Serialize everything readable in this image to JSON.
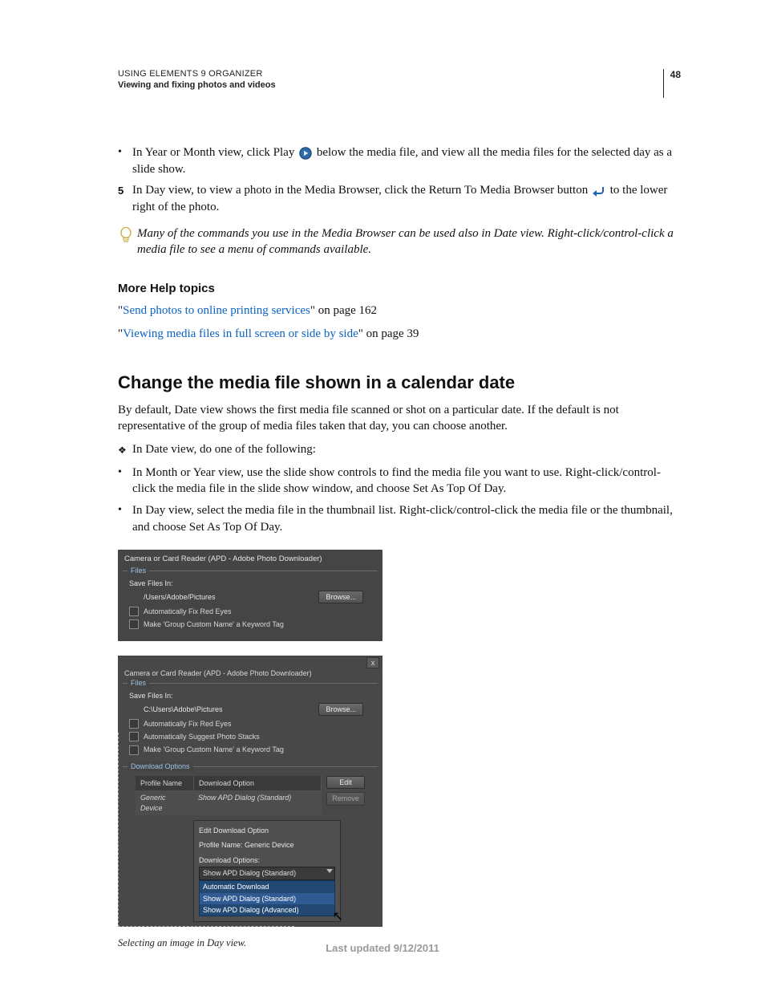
{
  "header": {
    "running_title": "USING ELEMENTS 9 ORGANIZER",
    "running_sub": "Viewing and fixing photos and videos",
    "page_number": "48"
  },
  "bullet1_a": "In Year or Month view, click Play ",
  "bullet1_b": " below the media file, and view all the media files for the selected day as a slide show.",
  "step5": {
    "num": "5",
    "a": "In Day view, to view a photo in the Media Browser, click the Return To Media Browser button ",
    "b": " to the lower right of the photo."
  },
  "tip": "Many of the commands you use in the Media Browser can be used also in Date view. Right-click/control-click a media file to see a menu of commands available.",
  "more_help": {
    "heading": "More Help topics",
    "link1": "Send photos to online printing services",
    "suffix1": "\" on page 162",
    "link2": "Viewing media files in full screen or side by side",
    "suffix2": "\" on page 39"
  },
  "section": {
    "h2": "Change the media file shown in a calendar date",
    "intro": "By default, Date view shows the first media file scanned or shot on a particular date. If the default is not representative of the group of media files taken that day, you can choose another.",
    "lead": "In Date view, do one of the following:",
    "b1": "In Month or Year view, use the slide show controls to find the media file you want to use. Right-click/control-click the media file in the slide show window, and choose Set As Top Of Day.",
    "b2": "In Day view, select the media file in the thumbnail list. Right-click/control-click the media file or the thumbnail, and choose Set As Top Of Day."
  },
  "shot1": {
    "title": "Camera or Card Reader (APD - Adobe Photo Downloader)",
    "files_legend": "Files",
    "save_label": "Save Files In:",
    "path": "/Users/Adobe/Pictures",
    "browse": "Browse...",
    "cb1": "Automatically Fix Red Eyes",
    "cb2": "Make 'Group Custom Name' a Keyword Tag"
  },
  "shot2": {
    "title": "Camera or Card Reader (APD - Adobe Photo Downloader)",
    "files_legend": "Files",
    "save_label": "Save Files In:",
    "path": "C:\\Users\\Adobe\\Pictures",
    "browse": "Browse...",
    "cb1": "Automatically Fix Red Eyes",
    "cb2": "Automatically Suggest Photo Stacks",
    "cb3": "Make 'Group Custom Name' a Keyword Tag",
    "dl_legend": "Download Options",
    "th_profile": "Profile Name",
    "th_option": "Download Option",
    "td_profile": "Generic Device",
    "td_option": "Show APD Dialog (Standard)",
    "edit": "Edit",
    "remove": "Remove",
    "panel_header": "Edit Download Option",
    "panel_profile_label": "Profile Name: Generic Device",
    "panel_dl_label": "Download Options:",
    "selected": "Show APD Dialog (Standard)",
    "opts": [
      "Automatic Download",
      "Show APD Dialog (Standard)",
      "Show APD Dialog (Advanced)"
    ]
  },
  "caption": "Selecting an image in Day view.",
  "footer": "Last updated 9/12/2011"
}
